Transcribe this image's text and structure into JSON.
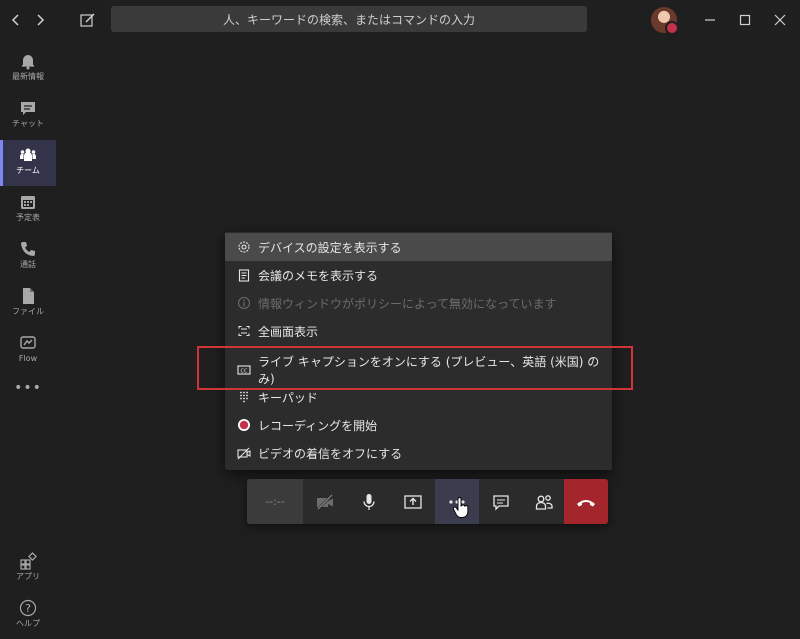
{
  "search": {
    "placeholder": "人、キーワードの検索、またはコマンドの入力"
  },
  "rail": {
    "items": [
      {
        "label": "最新情報",
        "icon": "bell-icon"
      },
      {
        "label": "チャット",
        "icon": "chat-icon"
      },
      {
        "label": "チーム",
        "icon": "teams-icon",
        "active": true
      },
      {
        "label": "予定表",
        "icon": "calendar-icon"
      },
      {
        "label": "通話",
        "icon": "phone-icon"
      },
      {
        "label": "ファイル",
        "icon": "file-icon"
      },
      {
        "label": "Flow",
        "icon": "flow-icon"
      }
    ],
    "more": "•••",
    "apps_label": "アプリ",
    "help_label": "ヘルプ"
  },
  "menu": {
    "items": [
      {
        "label": "デバイスの設定を表示する",
        "icon": "gear-icon"
      },
      {
        "label": "会議のメモを表示する",
        "icon": "notes-icon"
      },
      {
        "label": "情報ウィンドウがポリシーによって無効になっています",
        "icon": "info-icon",
        "disabled": true
      },
      {
        "label": "全画面表示",
        "icon": "fullscreen-icon"
      },
      {
        "label": "ライブ キャプションをオンにする (プレビュー、英語 (米国) のみ)",
        "icon": "cc-icon"
      },
      {
        "label": "キーパッド",
        "icon": "keypad-icon"
      },
      {
        "label": "レコーディングを開始",
        "icon": "record-icon"
      },
      {
        "label": "ビデオの着信をオフにする",
        "icon": "video-off-icon"
      }
    ]
  },
  "callbar": {
    "timer": "--:--"
  },
  "colors": {
    "accent": "#7f85f5",
    "hangup": "#a4262c",
    "highlight": "#d13438",
    "record": "#c4314b"
  }
}
